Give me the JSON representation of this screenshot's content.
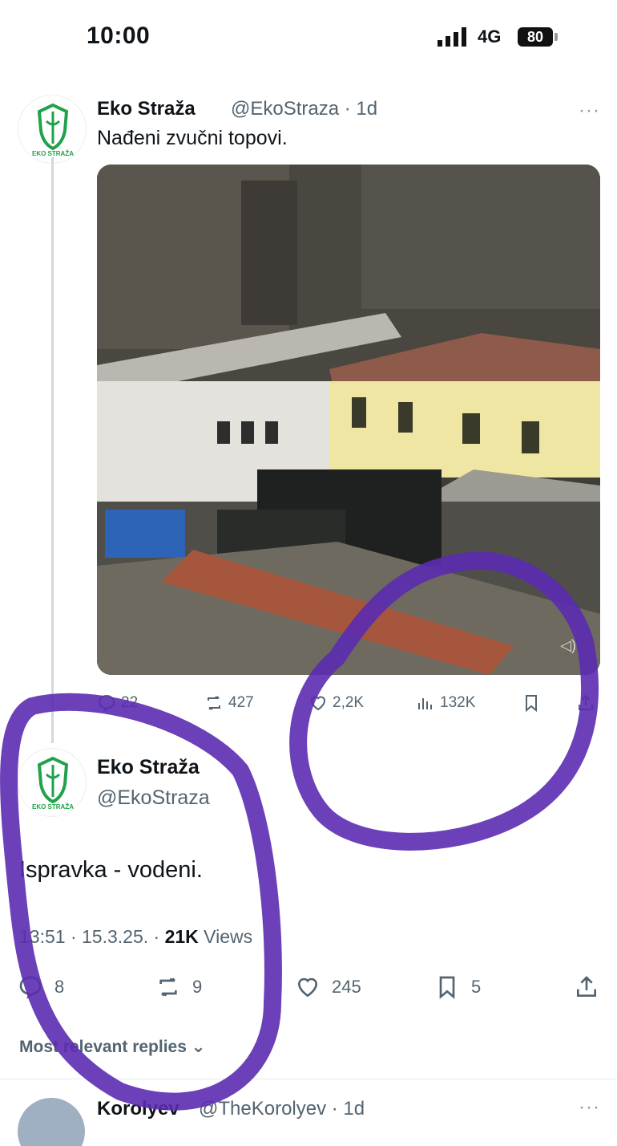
{
  "status_bar": {
    "time": "10:00",
    "network": "4G",
    "battery": "80"
  },
  "tweet": {
    "display_name": "Eko Straža",
    "handle_time": "@EkoStraza · 1d",
    "text": "Nađeni zvučni topovi.",
    "avatar_label": "EKO STRAŽA",
    "stats": {
      "replies": "22",
      "reposts": "427",
      "likes": "2,2K",
      "views": "132K"
    }
  },
  "focused_tweet": {
    "display_name": "Eko Straža",
    "handle": "@EkoStraza",
    "text": "Ispravka - vodeni.",
    "meta": "13:51 · 15.3.25. · ",
    "views_count": "21K",
    "views_label": " Views",
    "stats": {
      "replies": "8",
      "reposts": "9",
      "likes": "245",
      "bookmarks": "5"
    }
  },
  "replies_sort_label": "Most relevant replies",
  "reply": {
    "display_name": "Korolyev",
    "handle_time": "@TheKorolyev · 1d"
  },
  "colors": {
    "annotation": "#5b2bb0",
    "brand_green": "#21a14a"
  }
}
